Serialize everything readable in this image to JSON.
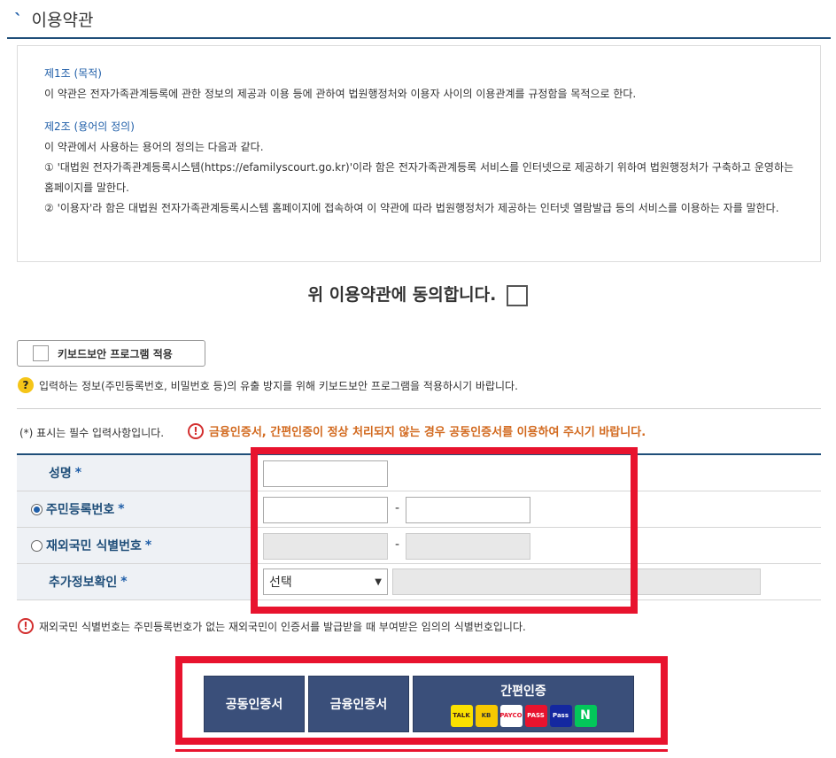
{
  "section_title": "이용약관",
  "terms": {
    "art1_title": "제1조 (목적)",
    "art1_body": "이 약관은 전자가족관계등록에 관한 정보의 제공과 이용 등에 관하여 법원행정처와 이용자 사이의 이용관계를 규정함을 목적으로 한다.",
    "art2_title": "제2조 (용어의 정의)",
    "art2_body": "이 약관에서 사용하는 용어의 정의는 다음과 같다.",
    "art2_item1": "① '대법원 전자가족관계등록시스템(https://efamilyscourt.go.kr)'이라 함은 전자가족관계등록 서비스를 인터넷으로 제공하기 위하여 법원행정처가 구축하고 운영하는 홈페이지를 말한다.",
    "art2_item2": "② '이용자'라 함은 대법원 전자가족관계등록시스템 홈페이지에 접속하여 이 약관에 따라 법원행정처가 제공하는 인터넷 열람발급 등의 서비스를 이용하는 자를 말한다."
  },
  "agree_label": "위 이용약관에 동의합니다.",
  "keyboard_button_label": "키보드보안 프로그램 적용",
  "keyboard_notice": "입력하는 정보(주민등록번호, 비밀번호 등)의 유출 방지를 위해 키보드보안 프로그램을 적용하시기 바랍니다.",
  "required_note": "(*) 표시는 필수 입력사항입니다.",
  "warning": "금융인증서, 간편인증이 정상 처리되지 않는 경우 공동인증서를 이용하여 주시기 바랍니다.",
  "form": {
    "name_label": "성명",
    "rrn_label": "주민등록번호",
    "foreign_label": "재외국민 식별번호",
    "extra_label": "추가정보확인",
    "required_mark": "*",
    "dash": "-",
    "select_value": "선택",
    "rrn_selected": true
  },
  "foreign_info": "재외국민 식별번호는 주민등록번호가 없는 재외국민이 인증서를 발급받을 때 부여받은 임의의 식별번호입니다.",
  "buttons": {
    "joint_cert": "공동인증서",
    "finance_cert": "금융인증서",
    "simple_auth": "간편인증"
  },
  "brands": [
    {
      "name": "TALK",
      "bg": "#fae100",
      "fg": "#3c1e1e"
    },
    {
      "name": "KB",
      "bg": "#f7c900",
      "fg": "#333333"
    },
    {
      "name": "PAYCO",
      "bg": "#ffffff",
      "fg": "#e8132e"
    },
    {
      "name": "PASS",
      "bg": "#e8132e",
      "fg": "#ffffff"
    },
    {
      "name": "Pass",
      "bg": "#1428a0",
      "fg": "#ffffff"
    },
    {
      "name": "N",
      "bg": "#03c75a",
      "fg": "#ffffff"
    }
  ],
  "colors": {
    "accent_blue": "#1f5ea8",
    "button_navy": "#3a4f7a",
    "highlight_red": "#e8132e",
    "warning_orange": "#d2691e"
  }
}
